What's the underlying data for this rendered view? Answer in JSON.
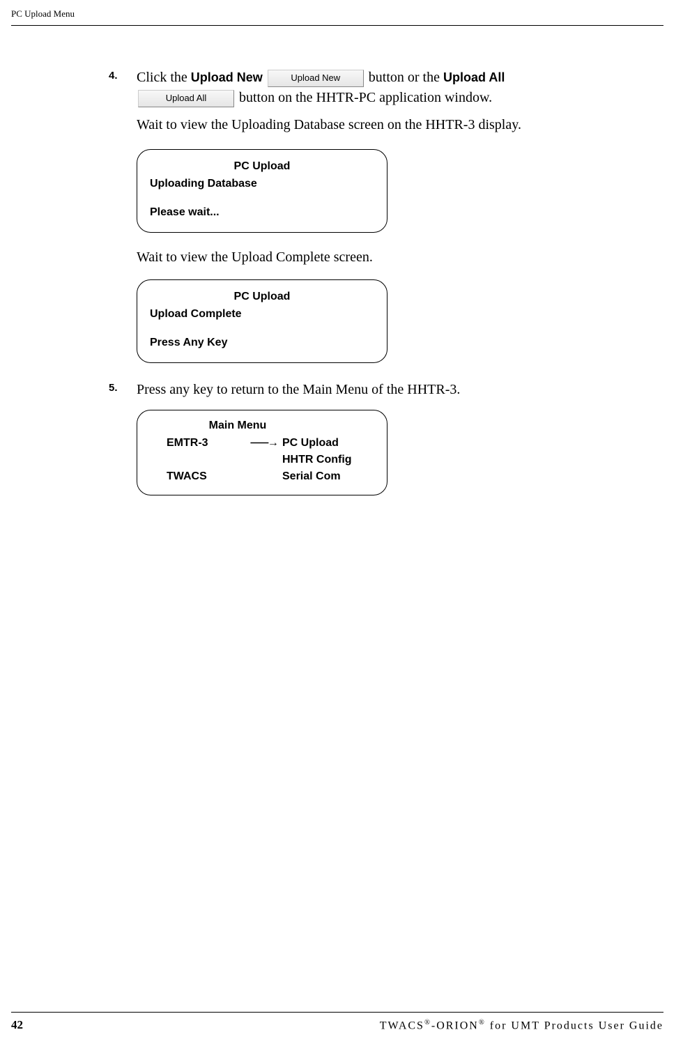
{
  "header": {
    "title": "PC Upload Menu"
  },
  "step4": {
    "number": "4.",
    "text1": "Click the ",
    "bold1": "Upload New",
    "btn1": "Upload New",
    "text2": " button or the ",
    "bold2": "Upload All",
    "btn2": "Upload All",
    "text3": " button on the HHTR-PC application window.",
    "text4": "Wait to view the Uploading Database screen on the HHTR-3 display."
  },
  "screen1": {
    "title": "PC Upload",
    "line1": "Uploading Database",
    "line2": "Please wait..."
  },
  "para1": "Wait to view the Upload Complete screen.",
  "screen2": {
    "title": "PC Upload",
    "line1": "Upload Complete",
    "line2": "Press Any Key"
  },
  "step5": {
    "number": "5.",
    "text": "Press any key to return to the Main Menu of the HHTR-3."
  },
  "menu": {
    "title": "Main Menu",
    "row1_left": "EMTR-3",
    "row1_right": "PC Upload",
    "row2_right": "HHTR Config",
    "row3_left": "TWACS",
    "row3_right": "Serial Com"
  },
  "footer": {
    "page": "42",
    "text_pre": "TWACS",
    "text_mid": "-ORION",
    "text_post": " for UMT Products User Guide"
  }
}
